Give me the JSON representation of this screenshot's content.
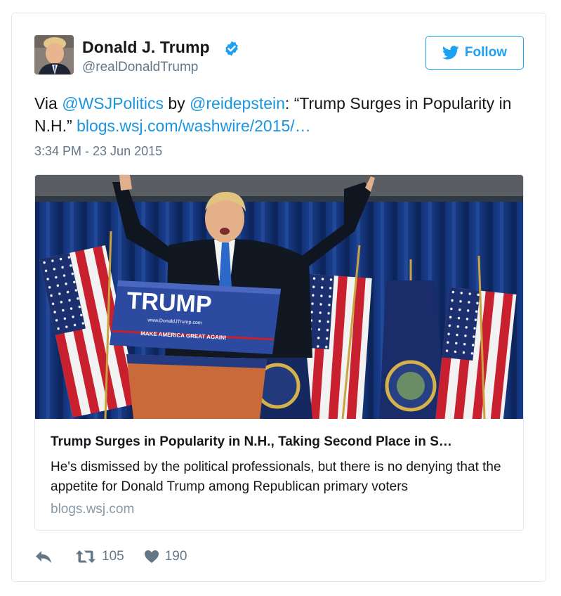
{
  "user": {
    "display_name": "Donald J. Trump",
    "handle": "@realDonaldTrump",
    "verified": true
  },
  "follow_button": {
    "label": "Follow"
  },
  "tweet": {
    "text_prefix": "Via ",
    "mention_1": "@WSJPolitics",
    "text_by": " by ",
    "mention_2": "@reidepstein",
    "text_quote": ": “Trump Surges in Popularity in N.H.” ",
    "link": "blogs.wsj.com/washwire/2015/…",
    "timestamp": "3:34 PM - 23 Jun 2015"
  },
  "card": {
    "podium_text": "TRUMP",
    "podium_url": "www.DonaldJTrump.com",
    "podium_slogan": "MAKE AMERICA GREAT AGAIN!",
    "title": "Trump Surges in Popularity in N.H., Taking Second Place in S…",
    "description": "He's dismissed by the political professionals, but there is no denying that the appetite for Donald Trump among Republican primary voters",
    "domain": "blogs.wsj.com"
  },
  "actions": {
    "retweet_count": "105",
    "like_count": "190"
  },
  "colors": {
    "accent": "#1da1f2",
    "link": "#1b95e0",
    "text": "#14171a",
    "muted": "#657786",
    "border": "#e1e8ed"
  },
  "icons": [
    "verified-icon",
    "twitter-bird-icon",
    "reply-icon",
    "retweet-icon",
    "heart-icon"
  ]
}
